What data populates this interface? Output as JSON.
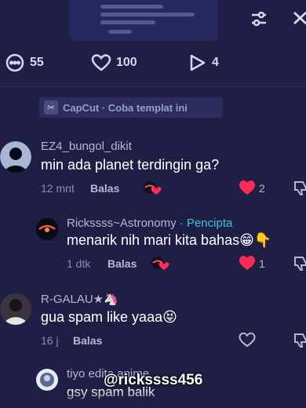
{
  "stats": {
    "comments_count": "55",
    "likes_count": "100",
    "shares_count": "4"
  },
  "banner": {
    "text": "CapCut · Coba templat ini"
  },
  "comments": [
    {
      "username": "EZ4_bungol_dikit",
      "text": "min ada planet terdingin ga?",
      "time": "12 mnt",
      "reply_label": "Balas",
      "likes": "2",
      "liked": true
    },
    {
      "username": "Rickssss~Astronomy",
      "badge": "· Pencipta",
      "text": "menarik nih mari kita bahas😁👇",
      "time": "1 dtk",
      "reply_label": "Balas",
      "likes": "1",
      "liked": true
    },
    {
      "username": "R-GALAU★🦄",
      "text": "gua spam like yaaa😝",
      "time": "16 j",
      "reply_label": "Balas",
      "liked": false
    },
    {
      "username": "tiyo edita anime",
      "text": "gsy spam balik"
    }
  ],
  "watermark": "@rickssss456",
  "colors": {
    "background": "#1f1f45",
    "like_red": "#fe2c55",
    "creator_badge": "#3ec6d6"
  }
}
